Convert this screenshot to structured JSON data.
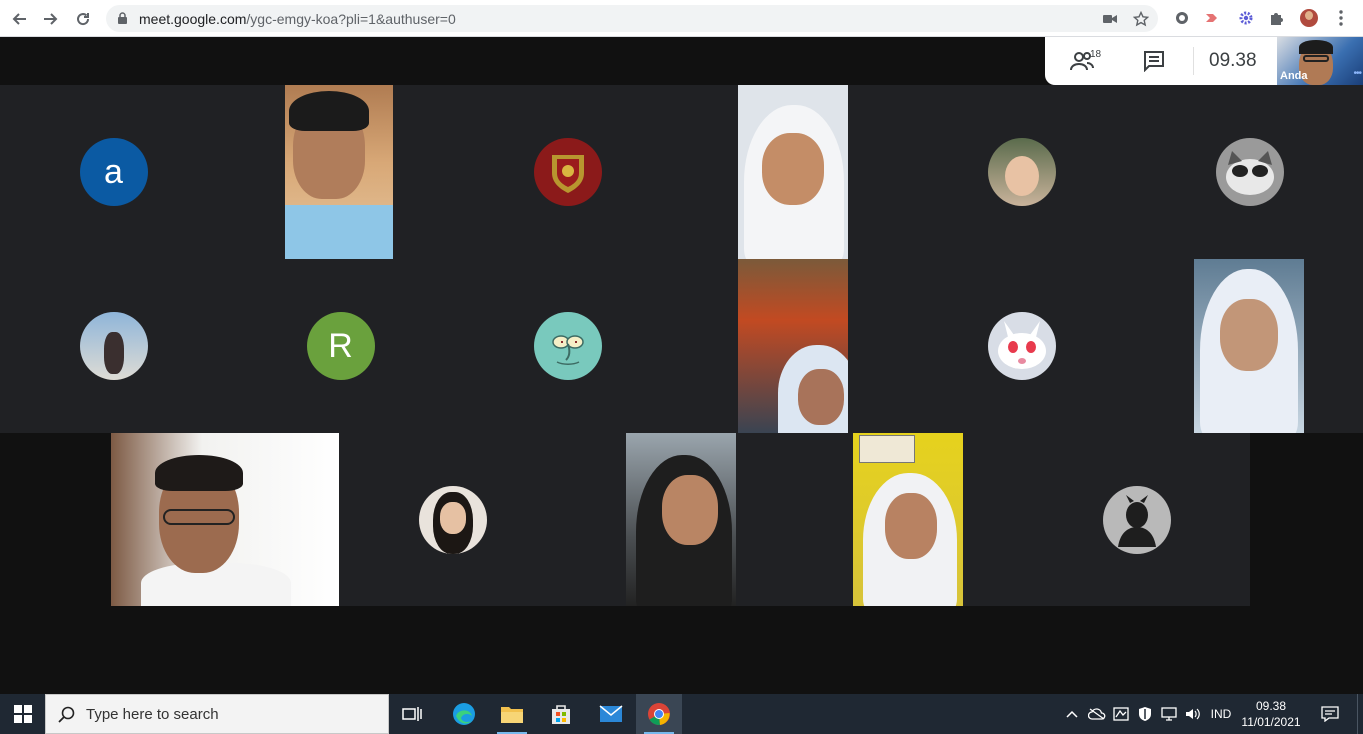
{
  "browser": {
    "url_host": "meet.google.com",
    "url_path": "/ygc-emgy-koa?pli=1&authuser=0"
  },
  "meet": {
    "participants_count": "18",
    "time": "09.38",
    "self_label": "Anda",
    "avatars": {
      "a": "a",
      "r": "R"
    }
  },
  "colors": {
    "avatar_a": "#0b5aa3",
    "avatar_r": "#6aa13d",
    "avatar_squidward": "#79c9bd"
  },
  "taskbar": {
    "search_placeholder": "Type here to search",
    "language": "IND",
    "clock_time": "09.38",
    "clock_date": "11/01/2021"
  }
}
